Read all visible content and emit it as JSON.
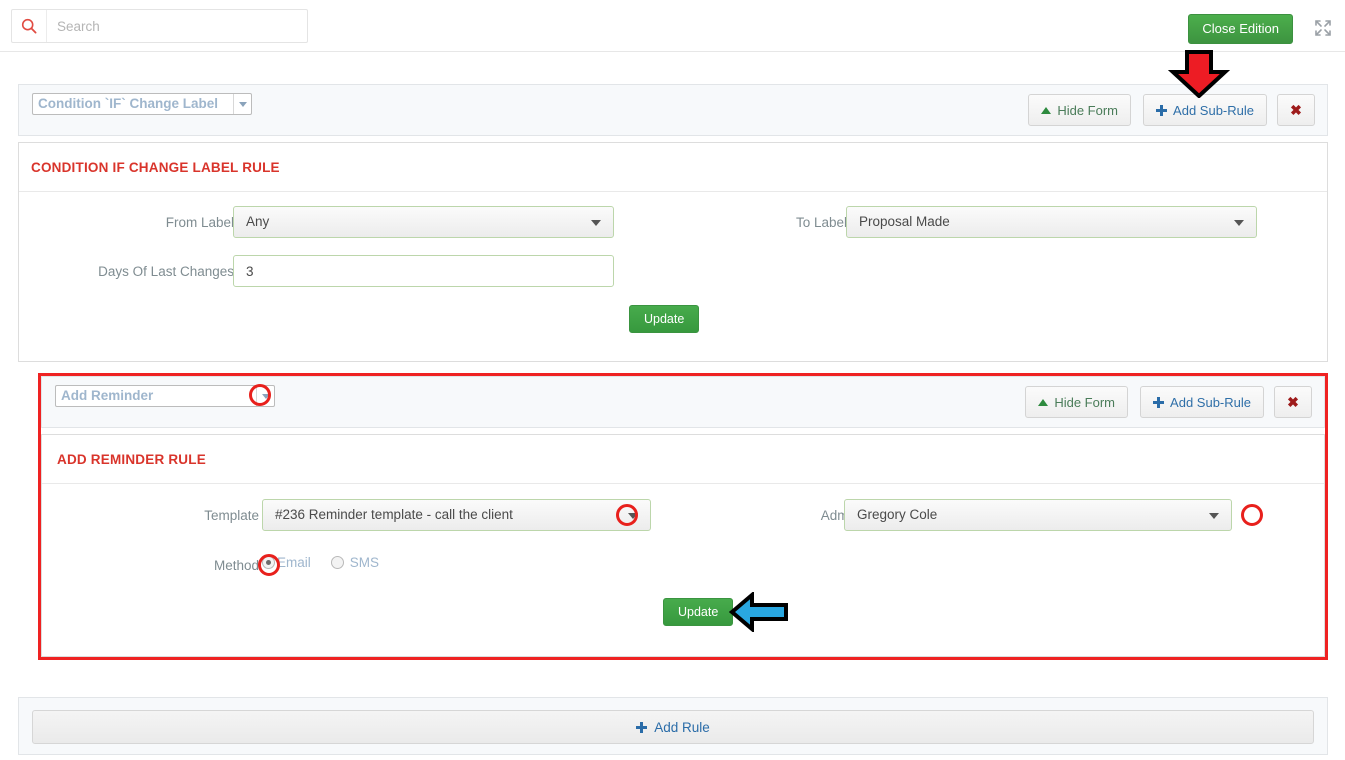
{
  "topbar": {
    "search_placeholder": "Search",
    "search_value": "",
    "search_icon": "search-icon",
    "close_edition_label": "Close Edition",
    "expand_icon": "expand-fullscreen-icon",
    "accent_green": "#3d9440",
    "accent_red": "#d9342b",
    "accent_blue": "#2a6ca8"
  },
  "rules": [
    {
      "select_value": "Condition `IF` Change Label",
      "hide_form_label": "Hide Form",
      "add_sub_rule_label": "Add Sub-Rule",
      "close_label": "✖",
      "title": "CONDITION IF CHANGE LABEL RULE",
      "fields": [
        {
          "label": "From Label",
          "value": "Any",
          "type": "select"
        },
        {
          "label": "To Label",
          "value": "Proposal Made",
          "type": "select"
        },
        {
          "label": "Days Of Last Changes",
          "value": "3",
          "type": "text"
        }
      ],
      "update_label": "Update"
    },
    {
      "select_value": "Add Reminder",
      "hide_form_label": "Hide Form",
      "add_sub_rule_label": "Add Sub-Rule",
      "close_label": "✖",
      "title": "ADD REMINDER RULE",
      "fields": [
        {
          "label": "Template",
          "value": "#236 Reminder template - call the client",
          "type": "select"
        },
        {
          "label": "Admin",
          "value": "Gregory Cole",
          "type": "select"
        },
        {
          "label": "Method",
          "type": "radio",
          "options": [
            {
              "label": "Email",
              "selected": true
            },
            {
              "label": "SMS",
              "selected": false
            }
          ]
        }
      ],
      "update_label": "Update"
    }
  ],
  "footer": {
    "add_rule_label": "Add Rule",
    "add_rule_icon": "plus-icon"
  },
  "annotations": {
    "red_down_arrow": "red-down-arrow-pointing-to-add-sub-rule",
    "blue_left_arrow": "blue-left-arrow-pointing-to-update-button",
    "red_highlight_box": "red-rectangle-around-add-reminder-rule",
    "red_circle_dropdown_rule": "red-circle-on-rule-select-caret",
    "red_circle_template": "red-circle-on-template-caret",
    "red_circle_admin": "red-circle-on-admin-caret",
    "red_circle_email_radio": "red-circle-on-email-radio"
  }
}
